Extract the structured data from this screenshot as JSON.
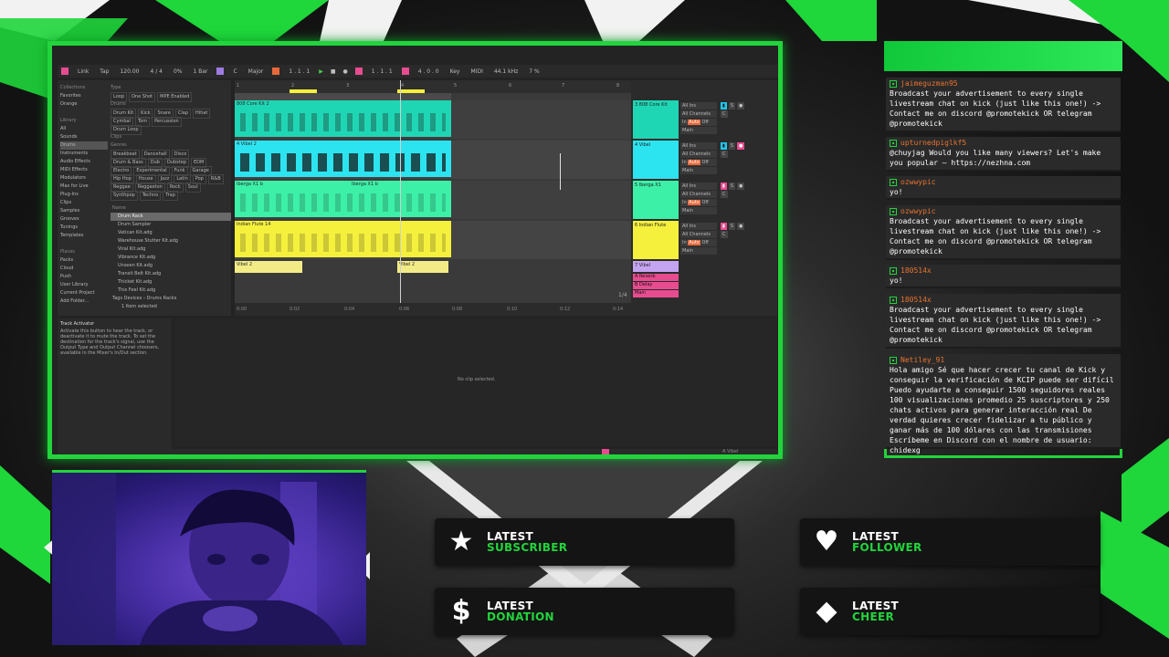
{
  "daw": {
    "toolbar": [
      "Link",
      "Tap",
      "120.00",
      "4 / 4",
      "0%",
      "1 Bar",
      "C",
      "Major",
      "1 . 1 . 1",
      "1 . 1 . 1",
      "4 . 0 . 0",
      "Key",
      "MIDI",
      "44.1 kHz",
      "7 %"
    ],
    "browser": {
      "collections_header": "Collections",
      "places": [
        "Favorites",
        "Orange",
        "",
        "Library",
        "All",
        "Sounds",
        "Drums",
        "Instruments",
        "Audio Effects",
        "MIDI Effects",
        "Modulators",
        "Max for Live",
        "Plug-Ins",
        "Clips",
        "Samples",
        "Grooves",
        "Tunings",
        "Templates",
        "",
        "Places",
        "Packs",
        "Cloud",
        "Push",
        "User Library",
        "Current Project",
        "Add Folder..."
      ],
      "type_header": "Type",
      "type_chips": [
        "Loop",
        "One Shot",
        "MPE Enabled"
      ],
      "drums_header": "Drums",
      "drum_chips": [
        "Drum Kit",
        "Kick",
        "Snare",
        "Clap",
        "Hihat",
        "Cymbal",
        "Tom",
        "Percussion",
        "Drum Loop"
      ],
      "clips_header": "Clips",
      "genres_header": "Genres",
      "genre_chips": [
        "Breakbeat",
        "Dancehall",
        "Disco",
        "Drum & Bass",
        "Dub",
        "Dubstep",
        "EDM",
        "Electro",
        "Experimental",
        "Funk",
        "Garage",
        "Hip Hop",
        "House",
        "Jazz",
        "Latin",
        "Pop",
        "R&B",
        "Reggae",
        "Reggaeton",
        "Rock",
        "Soul",
        "Synthpop",
        "Techno",
        "Trap"
      ],
      "name_header": "Name",
      "files": [
        "Drum Rack",
        "Drum Sampler",
        "Vatican Kit.adg",
        "Warehouse Stutter Kit.adg",
        "Viral Kit.adg",
        "Vibrance Kit.adg",
        "Unseen Kit.adg",
        "Transit Belt Kit.adg",
        "Thicket Kit.adg",
        "This Feel Kit.adg"
      ],
      "tags_row": "Tags  Devices › Drums   Racks",
      "selected_count": "1 Item selected"
    },
    "info": {
      "title": "Track Activator",
      "text": "Activate this button to hear the track, or deactivate it to mute the track. To set the destination for the track's signal, use the Output Type and Output Channel choosers, available in the Mixer's In/Out section."
    },
    "no_clip": "No clip selected.",
    "ruler": [
      "1",
      "2",
      "3",
      "4",
      "5",
      "6",
      "7",
      "8"
    ],
    "time_ruler": [
      "0:00",
      "0:02",
      "0:04",
      "0:06",
      "0:08",
      "0:10",
      "0:12",
      "0:14"
    ],
    "page": "1/4",
    "tracks": [
      {
        "clip": "808 Core Kit 2",
        "mixer": "3 808 Core Kit",
        "color": "#1fd6b4"
      },
      {
        "clip": "4 Vibel 2",
        "mixer": "4 Vibel",
        "color": "#2ce4f0"
      },
      {
        "clip": "Iberga X1 b",
        "clip2": "Iberga X1 b",
        "mixer": "5 Iberga X1",
        "color": "#3cf0a8"
      },
      {
        "clip": "Indian Flute 14",
        "mixer": "6 Indian Flute",
        "color": "#f5f03c"
      },
      {
        "clip": "Vibel 2",
        "clip2": "Vibel 2",
        "mixer": "7 Vibel",
        "color": "#f3ec86"
      }
    ],
    "returns": [
      "A Reverb",
      "B Delay",
      "Main"
    ],
    "mixer_io": [
      "All Ins",
      "All Channels",
      "In",
      "Auto",
      "Off",
      "Main"
    ],
    "status": "A Vibel"
  },
  "chat": {
    "messages": [
      {
        "user": "jaimeguzman95",
        "text": "Broadcast your advertisement to every single livestream chat on kick (just like this one!) -> Contact me on discord @promotekick OR telegram @promotekick"
      },
      {
        "user": "upturnedpiglkf5",
        "text": "@chuyjag Would you like many viewers? Let's make you popular — https://nezhna.com"
      },
      {
        "user": "ozwwypic",
        "text": "yo!"
      },
      {
        "user": "ozwwypic",
        "text": "Broadcast your advertisement to every single livestream chat on kick (just like this one!) -> Contact me on discord @promotekick OR telegram @promotekick"
      },
      {
        "user": "180514x",
        "text": "yo!"
      },
      {
        "user": "180514x",
        "text": "Broadcast your advertisement to every single livestream chat on kick (just like this one!) -> Contact me on discord @promotekick OR telegram @promotekick"
      },
      {
        "user": "Netiley_91",
        "text": "Hola amigo Sé que hacer crecer tu canal de Kick y conseguir la verificación de KCIP puede ser difícil Puedo ayudarte a conseguir 1500 seguidores reales 100 visualizaciones promedio 25 suscriptores y 250 chats activos para generar interacción real De verdad quieres crecer fidelizar a tu público y ganar más de 100 dólares con las transmisiones Escríbeme en Discord con el nombre de usuario: chidexg"
      }
    ]
  },
  "alerts": [
    {
      "icon": "★",
      "icon_name": "star-icon",
      "line1": "LATEST",
      "line2": "SUBSCRIBER"
    },
    {
      "icon": "♥",
      "icon_name": "heart-icon",
      "line1": "LATEST",
      "line2": "FOLLOWER"
    },
    {
      "icon": "$",
      "icon_name": "dollar-icon",
      "line1": "LATEST",
      "line2": "DONATION"
    },
    {
      "icon": "◆",
      "icon_name": "diamond-icon",
      "line1": "LATEST",
      "line2": "CHEER"
    }
  ],
  "colors": {
    "accent": "#22d43c",
    "username": "#e8732f"
  }
}
